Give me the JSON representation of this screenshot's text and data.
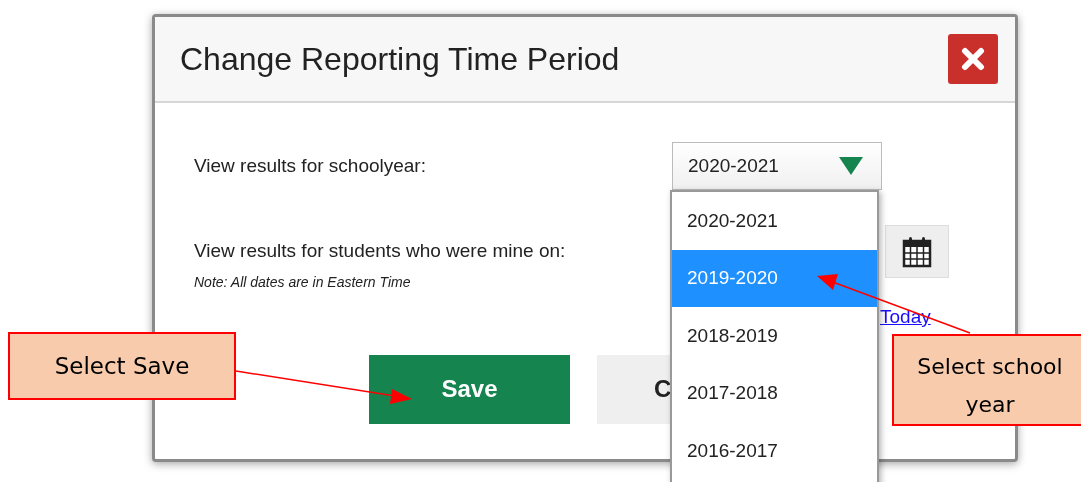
{
  "dialog": {
    "title": "Change Reporting Time Period",
    "schoolyear": {
      "label": "View results for schoolyear:",
      "value": "2020-2021",
      "expanded": true,
      "options": [
        {
          "label": "2020-2021",
          "highlighted": false
        },
        {
          "label": "2019-2020",
          "highlighted": true
        },
        {
          "label": "2018-2019",
          "highlighted": false
        },
        {
          "label": "2017-2018",
          "highlighted": false
        },
        {
          "label": "2016-2017",
          "highlighted": false
        }
      ]
    },
    "date_label": "View results for students who were mine on:",
    "note": "Note: All dates are in Eastern Time",
    "today_link": "Today",
    "save_button": "Save",
    "cancel_button": "C"
  },
  "callouts": [
    {
      "text": "Select Save"
    },
    {
      "text": "Select school year"
    }
  ]
}
